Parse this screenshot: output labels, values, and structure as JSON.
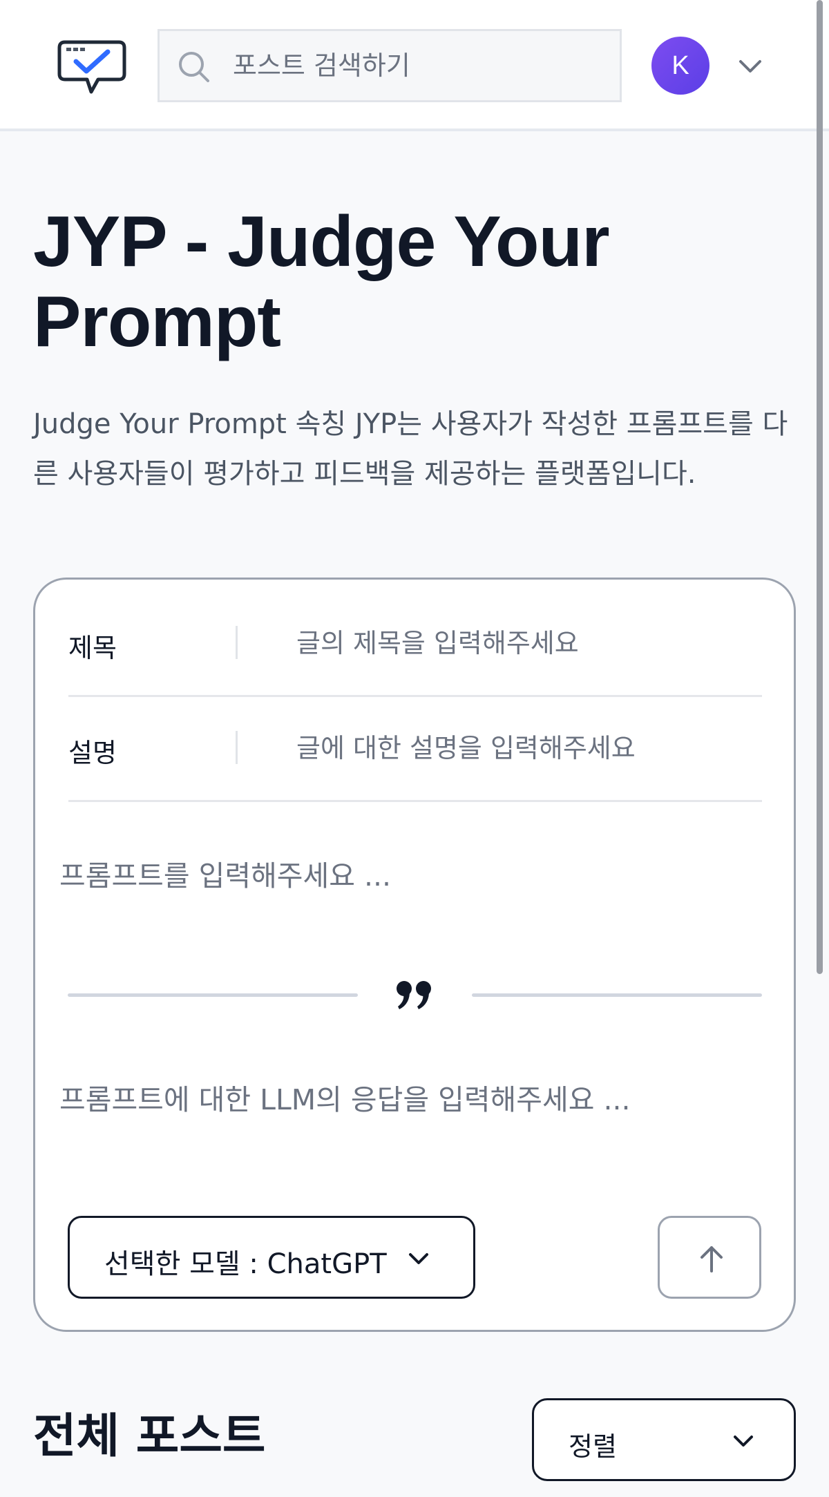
{
  "header": {
    "search": {
      "placeholder": "포스트 검색하기",
      "value": ""
    },
    "avatar_initial": "K",
    "avatar_color": "#6b46ec"
  },
  "hero": {
    "title": "JYP - Judge Your Prompt",
    "description": "Judge Your Prompt 속칭 JYP는 사용자가 작성한 프롬프트를 다른 사용자들이 평가하고 피드백을 제공하는 플랫폼입니다."
  },
  "composer": {
    "title_label": "제목",
    "title_placeholder": "글의 제목을 입력해주세요",
    "description_label": "설명",
    "description_placeholder": "글에 대한 설명을 입력해주세요",
    "prompt_placeholder": "프롬프트를 입력해주세요 ...",
    "response_placeholder": "프롬프트에 대한 LLM의 응답을 입력해주세요 ...",
    "model_label": "선택한 모델 : ChatGPT",
    "icons": {
      "quote": "quote-icon",
      "submit": "arrow-up-icon",
      "model_dropdown": "chevron-down-icon"
    }
  },
  "posts": {
    "section_title": "전체 포스트",
    "sort_label": "정렬"
  },
  "colors": {
    "accent": "#6b46ec",
    "logo_blue": "#2f6bff",
    "border_gray": "#9ca3af"
  }
}
